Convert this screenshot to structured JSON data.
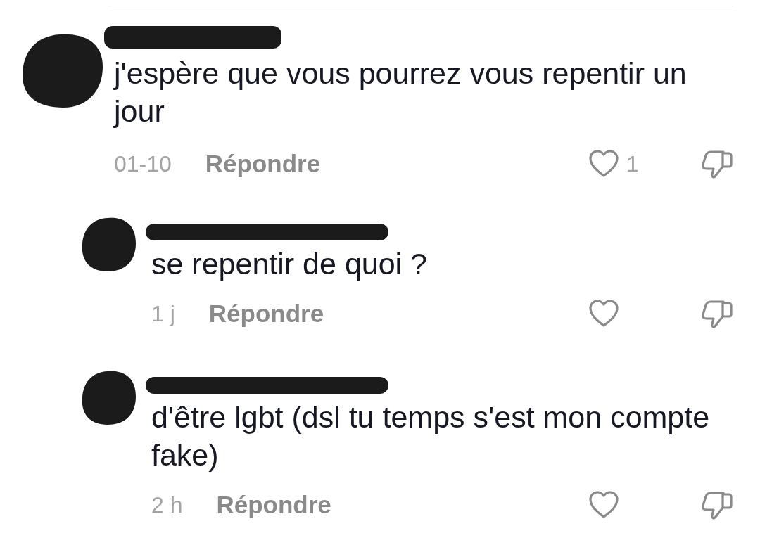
{
  "comments": [
    {
      "text": "j'espère que vous pourrez vous repentir un jour",
      "time": "01-10",
      "reply_label": "Répondre",
      "likes": "1",
      "children": [
        {
          "text": "se repentir de quoi ?",
          "time": "1 j",
          "reply_label": "Répondre"
        },
        {
          "text": "d'être lgbt (dsl tu temps s'est mon compte fake)",
          "time": "2 h",
          "reply_label": "Répondre"
        }
      ]
    }
  ]
}
